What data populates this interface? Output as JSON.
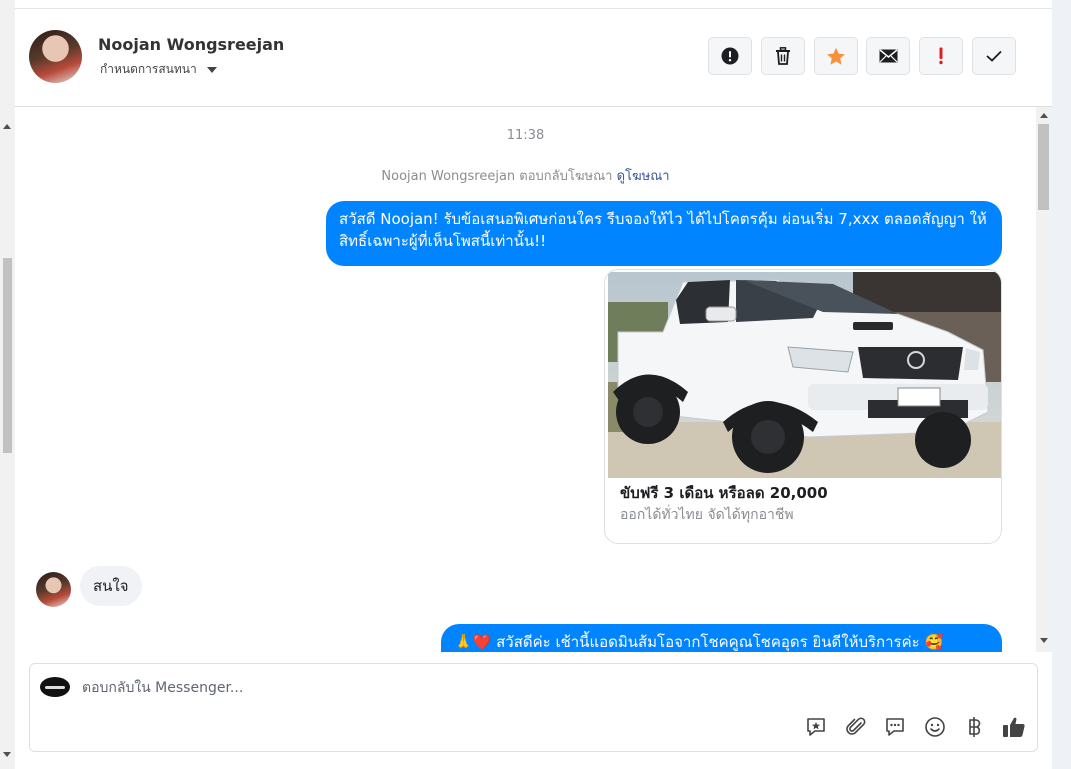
{
  "header": {
    "contact_name": "Noojan Wongsreejan",
    "conversation_menu_label": "กำหนดการสนทนา"
  },
  "toolbar": [
    {
      "name": "report-button",
      "icon": "exclamation-circle-icon"
    },
    {
      "name": "delete-button",
      "icon": "trash-icon"
    },
    {
      "name": "star-button",
      "icon": "star-icon",
      "color": "#f7923a"
    },
    {
      "name": "mark-unread-button",
      "icon": "envelope-icon"
    },
    {
      "name": "important-button",
      "icon": "exclamation-icon",
      "color": "#e02020"
    },
    {
      "name": "done-button",
      "icon": "check-icon"
    }
  ],
  "conversation": {
    "timestamp": "11:38",
    "ad_reply_prefix": "Noojan Wongsreejan ตอบกลับโฆษณา",
    "ad_reply_link": "ดูโฆษณา",
    "messages": [
      {
        "direction": "out",
        "text": "สวัสดี Noojan! รับข้อเสนอพิเศษก่อนใคร รีบจองให้ไว ได้ไปโคตรคุ้ม ผ่อนเริ่ม 7,xxx ตลอดสัญญา ให้สิทธิ์เฉพาะผู้ที่เห็นโพสนี้เท่านั้น!!"
      },
      {
        "direction": "out",
        "type": "ad_card",
        "title": "ขับฟรี 3 เดือน หรือลด 20,000",
        "subtitle": "ออกได้ทั่วไทย จัดได้ทุกอาชีพ"
      },
      {
        "direction": "in",
        "text": "สนใจ"
      },
      {
        "direction": "out",
        "text": "🙏❤️ สวัสดีค่ะ เช้านี้แอดมินส้มโอจากโชคคูณโชคอุดร ยินดีให้บริการค่ะ 🥰"
      }
    ]
  },
  "composer": {
    "placeholder": "ตอบกลับใน Messenger...",
    "icons": [
      "saved-reply-icon",
      "attachment-icon",
      "chat-bubble-icon",
      "emoji-icon",
      "baht-icon",
      "thumbs-up-icon"
    ]
  },
  "colors": {
    "outgoing_bubble": "#0084ff",
    "incoming_bubble": "#f0f2f5",
    "link": "#385898"
  }
}
